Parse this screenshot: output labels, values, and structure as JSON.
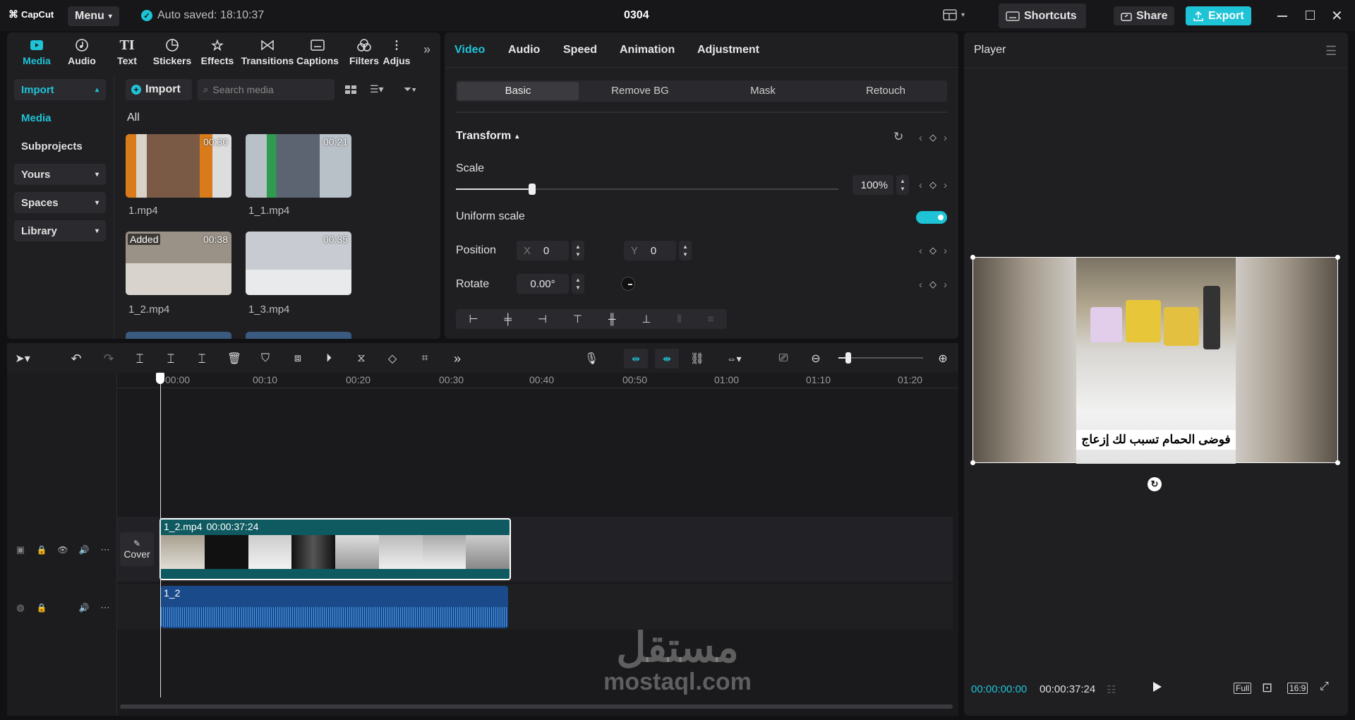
{
  "titlebar": {
    "logo": "CapCut",
    "menu_label": "Menu",
    "autosave_text": "Auto saved: 18:10:37",
    "project_title": "0304",
    "shortcuts_label": "Shortcuts",
    "share_label": "Share",
    "export_label": "Export"
  },
  "media_panel": {
    "tabs": [
      {
        "label": "Media",
        "icon": "media-icon",
        "active": true
      },
      {
        "label": "Audio",
        "icon": "audio-icon"
      },
      {
        "label": "Text",
        "icon": "text-icon"
      },
      {
        "label": "Stickers",
        "icon": "stickers-icon"
      },
      {
        "label": "Effects",
        "icon": "effects-icon"
      },
      {
        "label": "Transitions",
        "icon": "transitions-icon"
      },
      {
        "label": "Captions",
        "icon": "captions-icon"
      },
      {
        "label": "Filters",
        "icon": "filters-icon"
      },
      {
        "label": "Adjus",
        "icon": "adjust-icon"
      }
    ],
    "sidebar": [
      {
        "label": "Import",
        "active": true
      },
      {
        "label": "Media"
      },
      {
        "label": "Subprojects"
      },
      {
        "label": "Yours"
      },
      {
        "label": "Spaces"
      },
      {
        "label": "Library"
      }
    ],
    "import_button": "Import",
    "search_placeholder": "Search media",
    "filter_all": "All",
    "items": [
      {
        "name": "1.mp4",
        "duration": "00:30"
      },
      {
        "name": "1_1.mp4",
        "duration": "00:21"
      },
      {
        "name": "1_2.mp4",
        "duration": "00:38",
        "badge": "Added"
      },
      {
        "name": "1_3.mp4",
        "duration": "00:35"
      }
    ]
  },
  "properties": {
    "tabs": [
      "Video",
      "Audio",
      "Speed",
      "Animation",
      "Adjustment"
    ],
    "subtabs": [
      "Basic",
      "Remove BG",
      "Mask",
      "Retouch"
    ],
    "section_title": "Transform",
    "scale_label": "Scale",
    "scale_value": "100%",
    "scale_fraction": 0.2,
    "uniform_label": "Uniform scale",
    "uniform_on": true,
    "position_label": "Position",
    "pos_x_label": "X",
    "pos_x_value": "0",
    "pos_y_label": "Y",
    "pos_y_value": "0",
    "rotate_label": "Rotate",
    "rotate_value": "0.00°"
  },
  "player": {
    "title": "Player",
    "caption_text": "فوضى الحمام تسبب لك إزعاج",
    "current_time": "00:00:00:00",
    "total_time": "00:00:37:24",
    "full_label": "Full",
    "ratio_label": "16:9"
  },
  "timeline": {
    "ruler_labels": [
      "00:00",
      "00:10",
      "00:20",
      "00:30",
      "00:40",
      "00:50",
      "01:00",
      "01:10",
      "01:20"
    ],
    "video_clip_name": "1_2.mp4",
    "video_clip_duration": "00:00:37:24",
    "audio_clip_name": "1_2",
    "cover_label": "Cover"
  },
  "watermark": {
    "arabic": "مستقل",
    "latin": "mostaql.com"
  },
  "colors": {
    "accent": "#1fc3d6",
    "clip_teal": "#0e5a60",
    "audio_blue": "#1a4a8a"
  }
}
